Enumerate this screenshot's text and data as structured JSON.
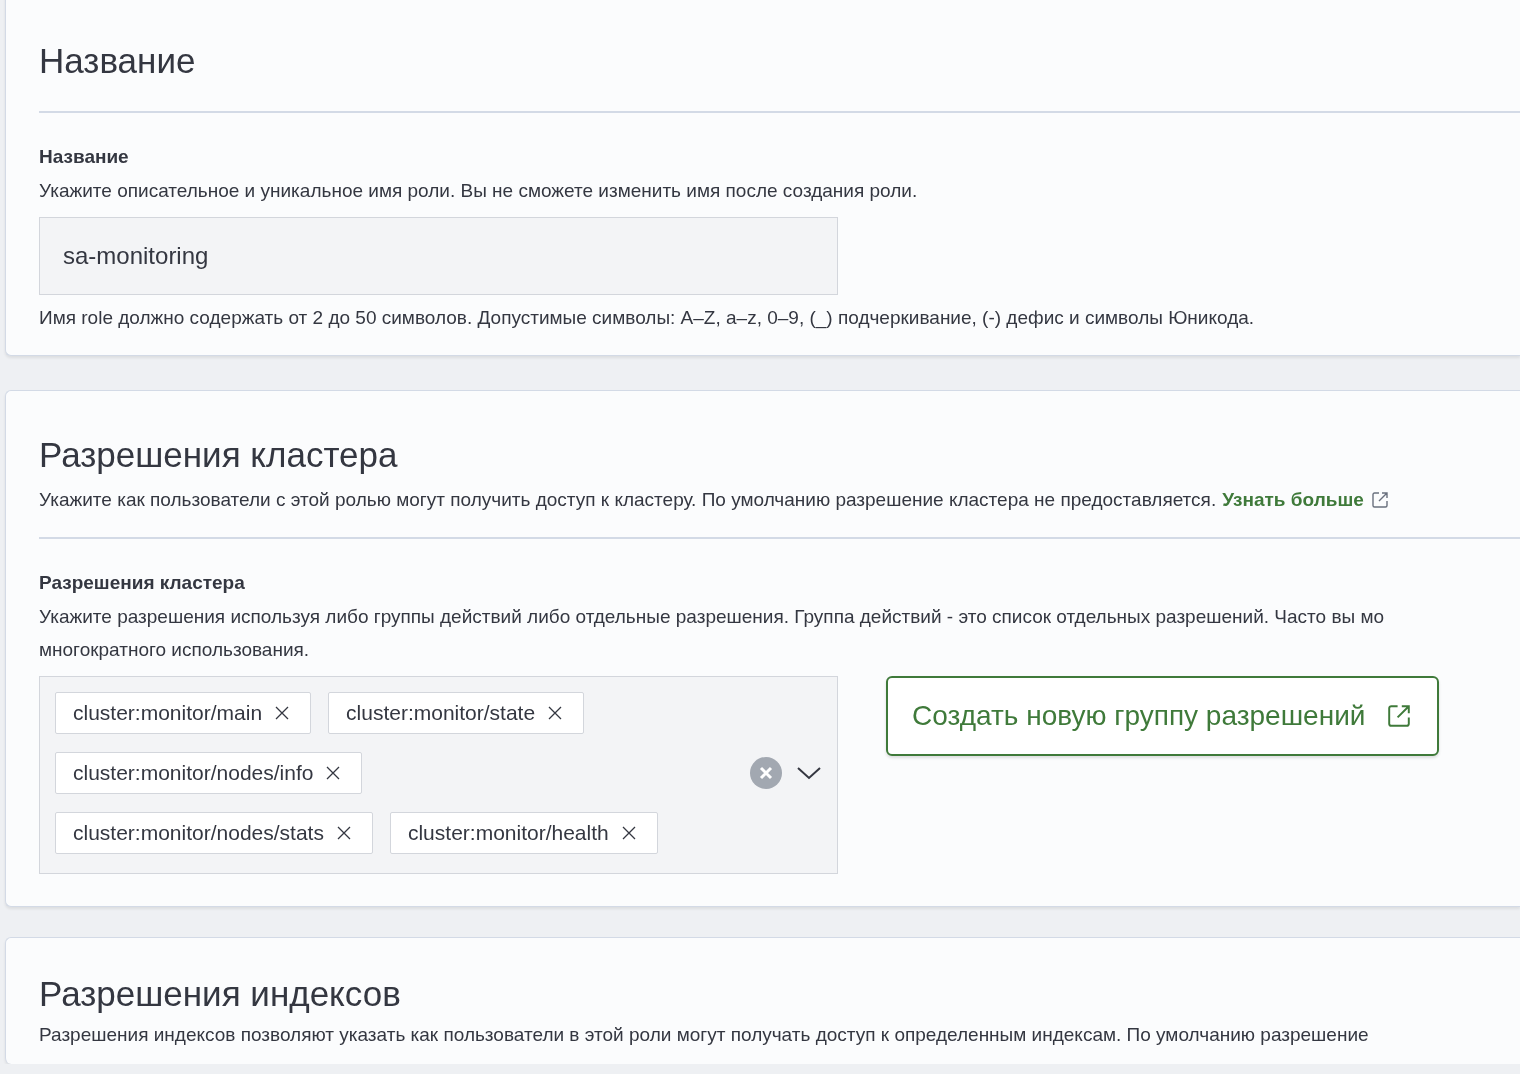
{
  "sections": [
    {
      "title": "Название",
      "fields": [
        {
          "kind": "text",
          "label": "Название",
          "description": "Укажите описательное и уникальное имя роли. Вы не сможете изменить имя после создания роли.",
          "value": "sa-monitoring",
          "help": "Имя role должно содержать от 2 до 50 символов. Допустимые символы: A–Z, a–z, 0–9, (_) подчеркивание, (-) дефис и символы Юникода."
        }
      ]
    },
    {
      "title": "Разрешения кластера",
      "description": "Укажите как пользователи с этой ролью могут получить доступ к кластеру. По умолчанию разрешение кластера не предоставляется.",
      "learn_more": "Узнать больше",
      "fields": [
        {
          "kind": "combo",
          "label": "Разрешения кластера",
          "description_lines": [
            "Укажите разрешения используя либо группы действий либо отдельные разрешения. Группа действий - это список отдельных разрешений. Часто вы мо",
            "многократного использования."
          ],
          "chips": [
            [
              "cluster:monitor/main",
              "cluster:monitor/state"
            ],
            [
              "cluster:monitor/nodes/info"
            ],
            [
              "cluster:monitor/nodes/stats",
              "cluster:monitor/health"
            ]
          ],
          "button": "Создать новую группу разрешений"
        }
      ]
    },
    {
      "title": "Разрешения индексов",
      "description": "Разрешения индексов позволяют указать как пользователи в этой роли могут получать доступ к определенным индексам. По умолчанию разрешение"
    }
  ]
}
